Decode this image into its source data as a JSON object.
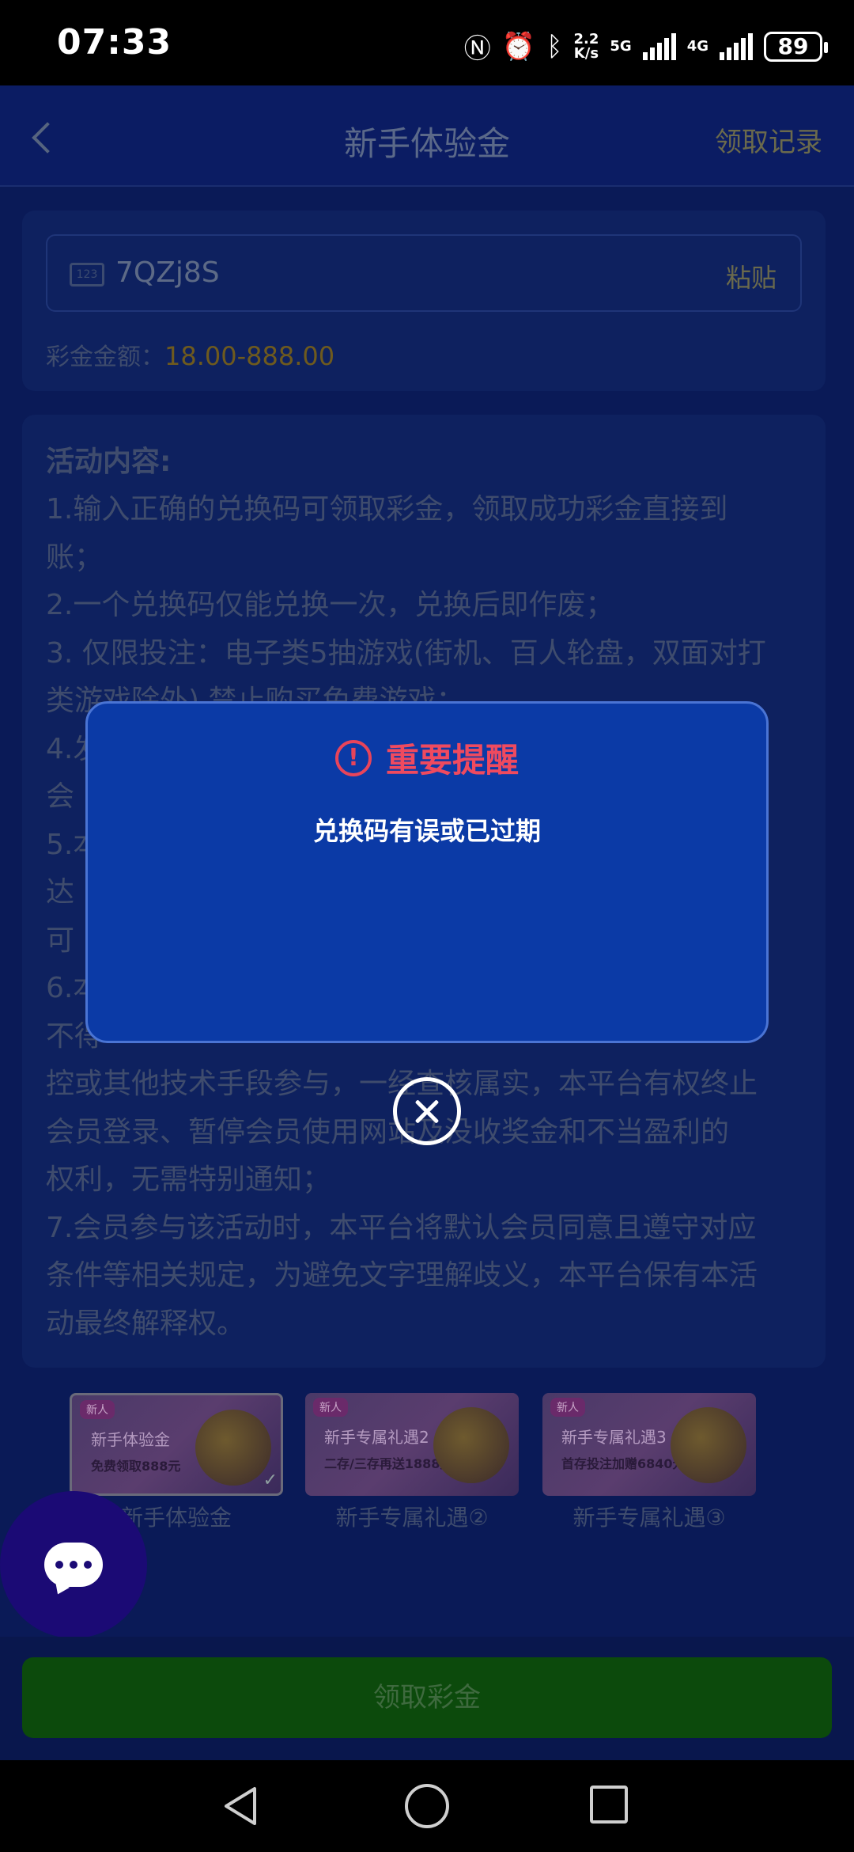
{
  "status_bar": {
    "time": "07:33",
    "net_speed_top": "2.2",
    "net_speed_bottom": "K/s",
    "net_5g": "5G",
    "net_4g": "4G",
    "battery": "89"
  },
  "header": {
    "title": "新手体验金",
    "records_label": "领取记录"
  },
  "code_card": {
    "code_icon_text": "123",
    "code_value": "7QZj8S",
    "paste_label": "粘贴",
    "amount_label": "彩金金额：",
    "amount_value": "18.00-888.00"
  },
  "rules": {
    "title": "活动内容:",
    "lines": [
      "1.输入正确的兑换码可领取彩金，领取成功彩金直接到",
      "账；",
      "2.一个兑换码仅能兑换一次，兑换后即作废；",
      "3. 仅限投注：电子类5抽游戏(街机、百人轮盘，双面对打",
      "类游戏除外) 禁止购买免费游戏；",
      "4.发",
      "会",
      "5.本",
      "达",
      "可",
      "6.本",
      "不得",
      "控或其他技术手段参与，一经查核属实，本平台有权终止",
      "会员登录、暂停会员使用网站及没收奖金和不当盈利的",
      "权利，无需特别通知；",
      "7.会员参与该活动时，本平台将默认会员同意且遵守对应",
      "条件等相关规定，为避免文字理解歧义，本平台保有本活",
      "动最终解释权。"
    ]
  },
  "promo_tabs": [
    {
      "badge": "新人",
      "title": "新手体验金",
      "subtitle": "免费领取888元",
      "label": "新手体验金"
    },
    {
      "badge": "新人",
      "title": "新手专属礼遇2",
      "subtitle": "二存/三存再送1888元",
      "label": "新手专属礼遇②"
    },
    {
      "badge": "新人",
      "title": "新手专属礼遇3",
      "subtitle": "首存投注加赠6840元",
      "label": "新手专属礼遇③"
    }
  ],
  "bottom": {
    "claim_label": "领取彩金"
  },
  "modal": {
    "icon_glyph": "!",
    "title": "重要提醒",
    "message": "兑换码有误或已过期"
  },
  "colors": {
    "background": "#0a1a57",
    "modal": "#0b3aa6",
    "alert": "#ef4a5f",
    "claim_button": "#0c4a0c"
  }
}
